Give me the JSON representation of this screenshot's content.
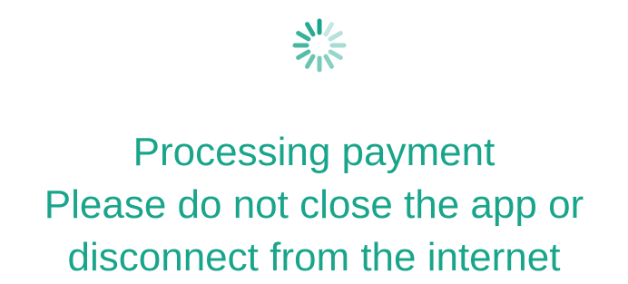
{
  "loader": {
    "icon": "loading-spinner-icon",
    "color": "#19a58b"
  },
  "message": {
    "title": "Processing payment",
    "line_1": "Please do not close the app or",
    "line_2": "disconnect from the internet"
  },
  "colors": {
    "accent": "#19a58b",
    "background": "#ffffff"
  }
}
